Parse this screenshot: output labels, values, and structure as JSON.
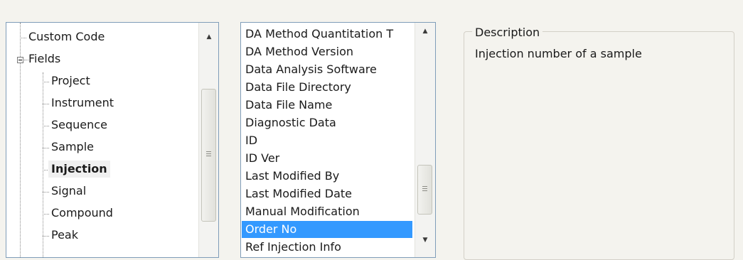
{
  "tree": {
    "items": [
      {
        "label": "Custom Code"
      },
      {
        "label": "Fields"
      },
      {
        "label": "Project"
      },
      {
        "label": "Instrument"
      },
      {
        "label": "Sequence"
      },
      {
        "label": "Sample"
      },
      {
        "label": "Injection",
        "selected": true
      },
      {
        "label": "Signal"
      },
      {
        "label": "Compound"
      },
      {
        "label": "Peak"
      }
    ]
  },
  "field_list": {
    "items": [
      {
        "label": "DA Method Quantitation T"
      },
      {
        "label": "DA Method Version"
      },
      {
        "label": "Data Analysis Software"
      },
      {
        "label": "Data File Directory"
      },
      {
        "label": "Data File Name"
      },
      {
        "label": "Diagnostic Data"
      },
      {
        "label": "ID"
      },
      {
        "label": "ID Ver"
      },
      {
        "label": "Last Modified By"
      },
      {
        "label": "Last Modified Date"
      },
      {
        "label": "Manual Modification"
      },
      {
        "label": "Order No",
        "selected": true
      },
      {
        "label": "Ref Injection Info"
      }
    ]
  },
  "description": {
    "legend": "Description",
    "text": "Injection number of a sample"
  },
  "colors": {
    "selection": "#3399ff",
    "panel_border": "#7f9db9",
    "background": "#f4f3ee"
  }
}
